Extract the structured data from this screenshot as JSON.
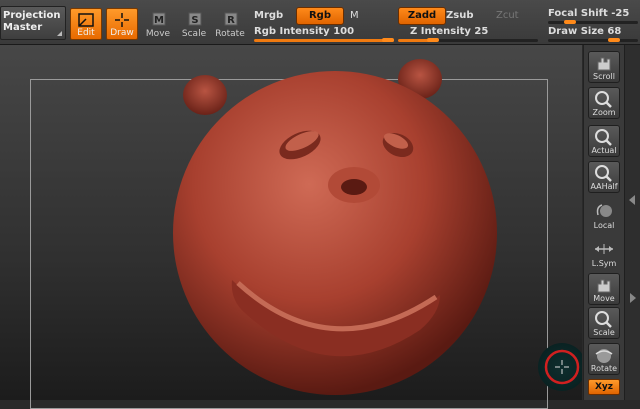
{
  "toolbar": {
    "projection_master": [
      "Projection",
      "Master"
    ],
    "edit": "Edit",
    "draw": "Draw",
    "move": "Move",
    "scale": "Scale",
    "rotate": "Rotate",
    "mrgb": "Mrgb",
    "rgb": "Rgb",
    "m": "M",
    "rgb_intensity_label": "Rgb Intensity",
    "rgb_intensity_value": "100",
    "rgb_intensity_fraction": 1.0,
    "zadd": "Zadd",
    "zsub": "Zsub",
    "zcut": "Zcut",
    "z_intensity_label": "Z Intensity",
    "z_intensity_value": "25",
    "z_intensity_fraction": 0.25,
    "focal_shift_label": "Focal Shift",
    "focal_shift_value": "-25",
    "draw_size_label": "Draw Size",
    "draw_size_value": "68"
  },
  "shelf": {
    "scroll": "Scroll",
    "zoom": "Zoom",
    "actual": "Actual",
    "aahalf": "AAHalf",
    "local": "Local",
    "lsym": "L.Sym",
    "move": "Move",
    "scale": "Scale",
    "rotate": "Rotate",
    "xyz": "Xyz"
  },
  "colors": {
    "accent": "#f07a10",
    "clay": "#a8402f",
    "brush_ring": "#d02020"
  }
}
